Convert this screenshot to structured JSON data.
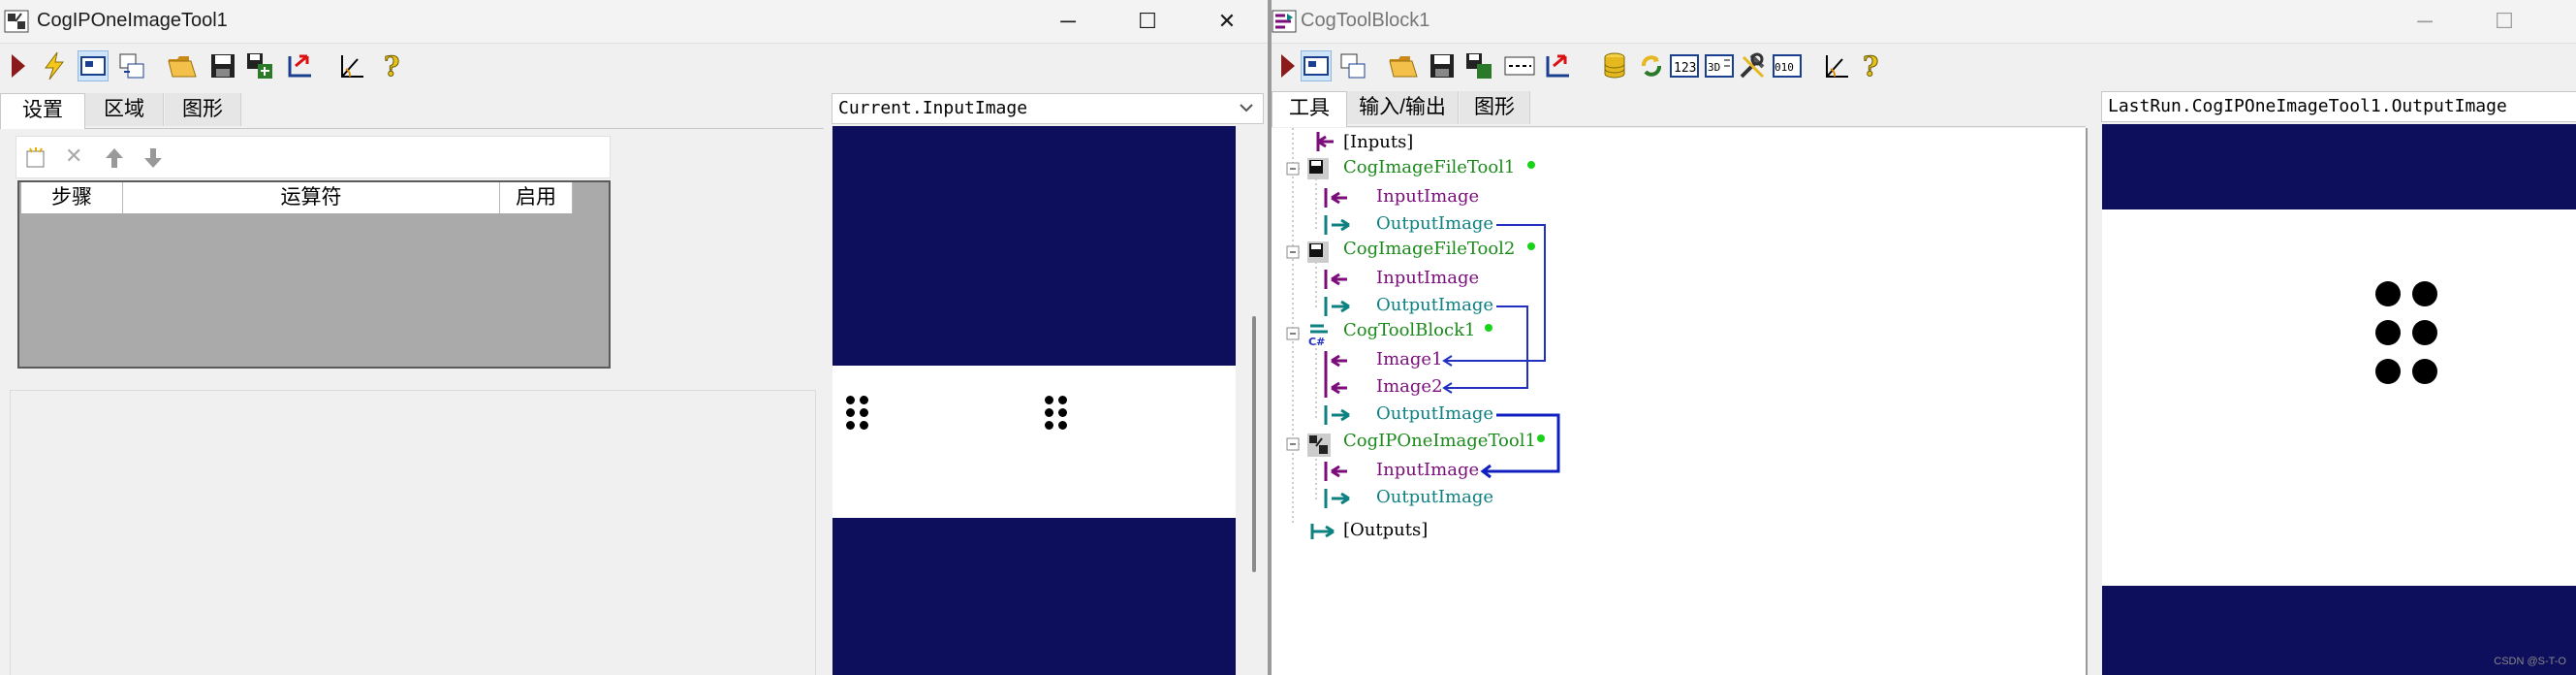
{
  "left_window": {
    "title": "CogIPOneImageTool1",
    "caption": {
      "minimize": "─",
      "maximize": "☐",
      "close": "✕"
    },
    "toolbar": [
      "run-icon",
      "flash-icon",
      "display-icon",
      "switch-display-icon",
      "open-folder-icon",
      "save-icon",
      "save-as-icon",
      "import-icon",
      "calibrate-icon",
      "help-icon"
    ],
    "tabs": [
      "设置",
      "区域",
      "图形"
    ],
    "step_table": {
      "columns": [
        "步骤",
        "运算符",
        "启用"
      ],
      "toolbar": [
        "new-icon",
        "delete-icon",
        "up-arrow-icon",
        "down-arrow-icon"
      ]
    },
    "view_selector": "Current.InputImage"
  },
  "right_window": {
    "title": "CogToolBlock1",
    "caption": {
      "minimize": "─",
      "maximize": "☐"
    },
    "toolbar": [
      "run-icon",
      "display-icon",
      "switch-display-icon",
      "open-folder-icon",
      "save-icon",
      "save-as-icon",
      "terminal-icon",
      "import-icon",
      "database-icon",
      "refresh-icon",
      "counter-icon",
      "script-icon",
      "tools-icon",
      "binary-icon",
      "calibrate-icon",
      "help-icon"
    ],
    "tabs": [
      "工具",
      "输入/输出",
      "图形"
    ],
    "tree": {
      "inputs": "[Inputs]",
      "outputs": "[Outputs]",
      "tool1": {
        "name": "CogImageFileTool1",
        "in": "InputImage",
        "out": "OutputImage"
      },
      "tool2": {
        "name": "CogImageFileTool2",
        "in": "InputImage",
        "out": "OutputImage"
      },
      "tool3": {
        "name": "CogToolBlock1",
        "in1": "Image1",
        "in2": "Image2",
        "out": "OutputImage"
      },
      "tool4": {
        "name": "CogIPOneImageTool1",
        "in": "InputImage",
        "out": "OutputImage"
      }
    },
    "view_selector": "LastRun.CogIPOneImageTool1.OutputImage"
  },
  "watermark": "CSDN @S-T-O",
  "colors": {
    "image_band": "#0d0e5c",
    "tool_green": "#1a8a1a",
    "input_purple": "#7a0d7a",
    "output_teal": "#0d8080",
    "link_blue": "#2030c0"
  }
}
